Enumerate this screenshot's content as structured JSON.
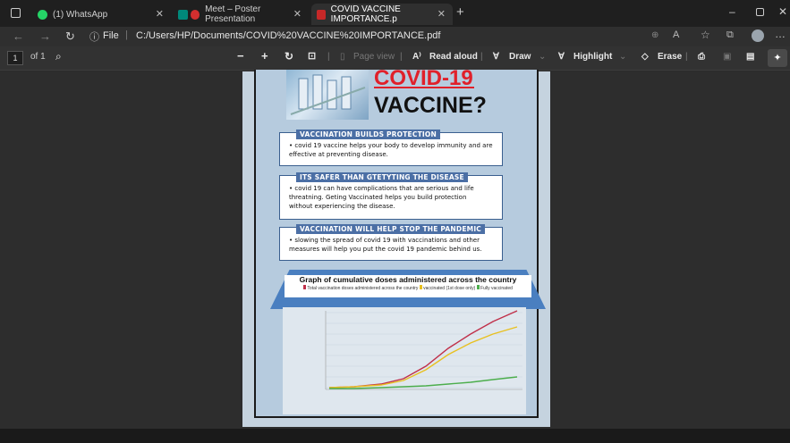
{
  "tabs": [
    {
      "label": "(1) WhatsApp"
    },
    {
      "label": "Meet – Poster Presentation"
    },
    {
      "label": "COVID VACCINE IMPORTANCE.p"
    }
  ],
  "address": {
    "file_label": "File",
    "url": "C:/Users/HP/Documents/COVID%20VACCINE%20IMPORTANCE.pdf"
  },
  "pdf_toolbar": {
    "page_input": "1",
    "page_of": "of 1",
    "page_view": "Page view",
    "read_aloud": "Read aloud",
    "draw": "Draw",
    "highlight": "Highlight",
    "erase": "Erase"
  },
  "poster": {
    "title_red": "COVID-19",
    "title_black": "VACCINE?",
    "sections": [
      {
        "heading": "VACCINATION BUILDS PROTECTION",
        "body": "covid 19 vaccine helps your body to develop immunity and are effective at preventing disease."
      },
      {
        "heading": "ITS SAFER THAN GTETYTING THE DISEASE",
        "body": "covid 19 can have complications that are serious and life threatning. Geting Vaccinated helps you build protection without experiencing the disease."
      },
      {
        "heading": "VACCINATION WILL HELP STOP THE PANDEMIC",
        "body": "slowing the spread of covid 19 with vaccinations and other measures will help you put the covid 19 pandemic behind us."
      }
    ],
    "graph_title": "Graph of cumulative doses administered across the country",
    "legend": [
      "Total vaccination doses administered across the country",
      "vaccinated (1st dose only)",
      "Fully vaccinated"
    ]
  },
  "colors": {
    "series_total": "#c0304a",
    "series_first": "#e8c020",
    "series_full": "#4cae4c"
  }
}
